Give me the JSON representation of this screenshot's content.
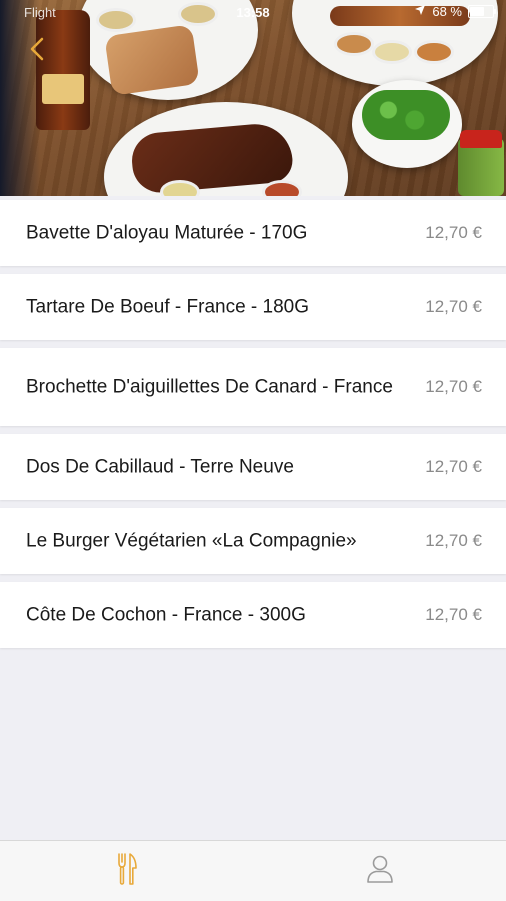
{
  "status_bar": {
    "carrier": "Flight",
    "time": "13:58",
    "battery": "68 %",
    "battery_level": 0.68
  },
  "header": {
    "back_icon": "chevron-left-icon",
    "accent_color": "#e8a93a"
  },
  "menu": {
    "items": [
      {
        "name": "Bavette D'aloyau Maturée - 170G",
        "price": "12,70 €"
      },
      {
        "name": "Tartare De Boeuf - France - 180G",
        "price": "12,70 €"
      },
      {
        "name": "Brochette D'aiguillettes De Canard - France",
        "price": "12,70 €"
      },
      {
        "name": "Dos De Cabillaud - Terre Neuve",
        "price": "12,70 €"
      },
      {
        "name": "Le Burger Végétarien «La Compagnie»",
        "price": "12,70 €"
      },
      {
        "name": "Côte De Cochon - France - 300G",
        "price": "12,70 €"
      }
    ]
  },
  "tab_bar": {
    "tabs": [
      {
        "icon": "fork-knife-icon",
        "active": true
      },
      {
        "icon": "user-icon",
        "active": false
      }
    ],
    "active_color": "#e8a93a",
    "inactive_color": "#9b9b9b"
  }
}
